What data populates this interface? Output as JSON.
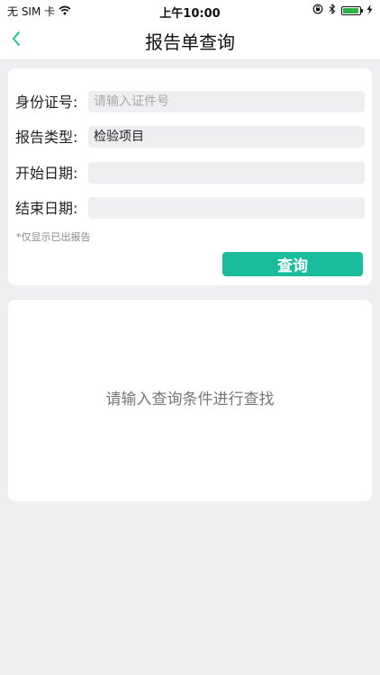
{
  "status_bar": {
    "carrier": "无 SIM 卡",
    "time": "上午10:00",
    "battery_level": 0.95
  },
  "nav": {
    "title": "报告单查询"
  },
  "form": {
    "id_label": "身份证号:",
    "id_placeholder": "请输入证件号",
    "id_value": "",
    "type_label": "报告类型:",
    "type_value": "检验项目",
    "start_label": "开始日期:",
    "start_value": "",
    "end_label": "结束日期:",
    "end_value": "",
    "note": "*仅显示已出报告",
    "query_label": "查询"
  },
  "result": {
    "message": "请输入查询条件进行查找"
  },
  "colors": {
    "accent": "#1bbc9b",
    "background": "#efeef0",
    "battery": "#2db34a"
  }
}
